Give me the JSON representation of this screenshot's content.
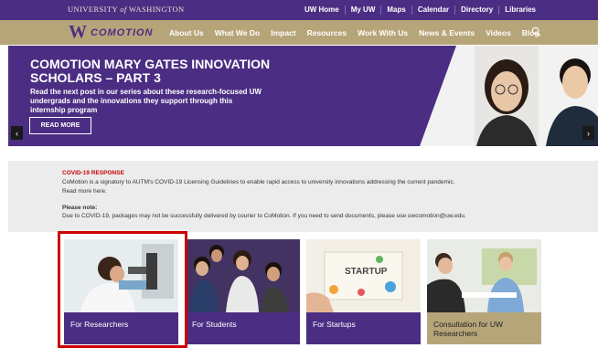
{
  "topbar": {
    "university_prefix": "UNIVERSITY",
    "university_of": "of",
    "university_suffix": "WASHINGTON",
    "links": [
      "UW Home",
      "My UW",
      "Maps",
      "Calendar",
      "Directory",
      "Libraries"
    ]
  },
  "nav": {
    "logo_mark": "W",
    "logo_text": "COMOTION",
    "links": [
      "About Us",
      "What We Do",
      "Impact",
      "Resources",
      "Work With Us",
      "News & Events",
      "Videos",
      "Blog"
    ],
    "search_icon": "search-icon"
  },
  "hero": {
    "title": "COMOTION MARY GATES INNOVATION SCHOLARS – PART 3",
    "subtitle": "Read the next post in our series about these research-focused UW undergrads and the innovations they support through this internship program",
    "button": "READ MORE",
    "prev": "‹",
    "next": "›"
  },
  "notice": {
    "covid_title": "COVID-19 RESPONSE",
    "covid_text": "CoMotion is a signatory to AUTM's COVID-19 Licensing Guidelines to enable rapid access to university innovations addressing the current pandemic.",
    "covid_more": "Read more here.",
    "note_title": "Please note:",
    "note_text": "Due to COVID-19, packages may not be successfully delivered by courier to CoMotion. If you need to send documents, please use uwcomotion@uw.edu."
  },
  "cards": [
    {
      "label": "For Researchers"
    },
    {
      "label": "For Students"
    },
    {
      "label": "For Startups"
    },
    {
      "label": "Consultation for UW Researchers"
    }
  ],
  "colors": {
    "purple": "#4b2e83",
    "gold": "#b7a57a",
    "highlight": "#cc0000"
  }
}
